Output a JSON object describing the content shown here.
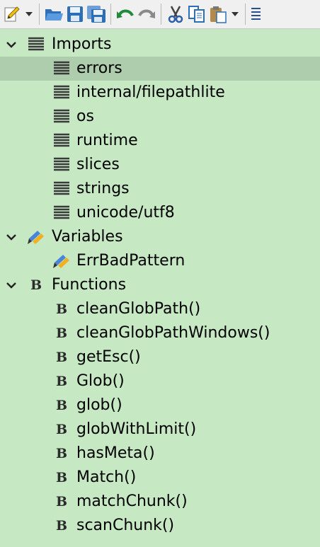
{
  "toolbar": {
    "buttons": [
      {
        "name": "new-file-button",
        "icon": "pencil-icon"
      },
      {
        "name": "new-menu-dropdown",
        "icon": "chevron-down-icon"
      },
      {
        "name": "open-folder-button",
        "icon": "folder-open-icon"
      },
      {
        "name": "save-button",
        "icon": "floppy-disk-icon"
      },
      {
        "name": "save-all-button",
        "icon": "floppy-disks-icon"
      },
      {
        "name": "undo-button",
        "icon": "undo-icon"
      },
      {
        "name": "redo-button",
        "icon": "redo-icon"
      },
      {
        "name": "cut-button",
        "icon": "scissors-icon"
      },
      {
        "name": "copy-button",
        "icon": "copy-icon"
      },
      {
        "name": "paste-button",
        "icon": "clipboard-icon"
      },
      {
        "name": "paste-dropdown",
        "icon": "chevron-down-icon"
      },
      {
        "name": "more-button",
        "icon": "lines-icon"
      }
    ]
  },
  "tree": {
    "imports": {
      "label": "Imports",
      "expanded": true,
      "items": [
        {
          "label": "errors",
          "selected": true
        },
        {
          "label": "internal/filepathlite"
        },
        {
          "label": "os"
        },
        {
          "label": "runtime"
        },
        {
          "label": "slices"
        },
        {
          "label": "strings"
        },
        {
          "label": "unicode/utf8"
        }
      ]
    },
    "variables": {
      "label": "Variables",
      "expanded": true,
      "items": [
        {
          "label": "ErrBadPattern"
        }
      ]
    },
    "functions": {
      "label": "Functions",
      "expanded": true,
      "items": [
        {
          "label": "cleanGlobPath()"
        },
        {
          "label": "cleanGlobPathWindows()"
        },
        {
          "label": "getEsc()"
        },
        {
          "label": "Glob()"
        },
        {
          "label": "glob()"
        },
        {
          "label": "globWithLimit()"
        },
        {
          "label": "hasMeta()"
        },
        {
          "label": "Match()"
        },
        {
          "label": "matchChunk()"
        },
        {
          "label": "scanChunk()"
        }
      ]
    }
  },
  "colors": {
    "background": "#c6e9c4",
    "selected_row": "#aecdac",
    "toolbar": "#f0f0f0"
  }
}
